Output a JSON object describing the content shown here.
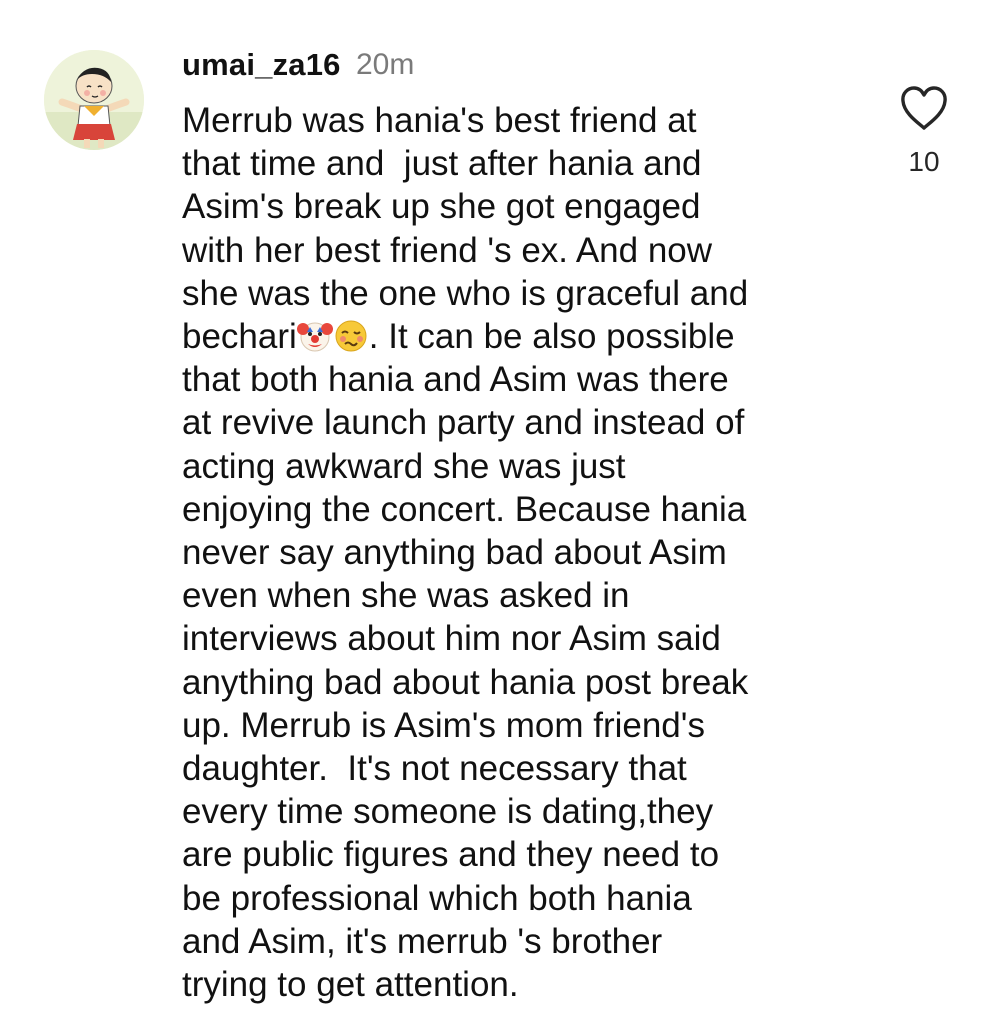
{
  "comment": {
    "username": "umai_za16",
    "timestamp": "20m",
    "like_count": "10",
    "avatar_icon": "cartoon-avatar-icon",
    "like_icon": "heart-outline-icon",
    "lines": [
      "Merrub was hania's best friend at",
      "that time and  just after hania and",
      "Asim's break up she got engaged",
      "with her best friend 's ex. And now",
      "she was the one who is graceful and",
      {
        "before": "bechari",
        "emojis": [
          "clown-face-emoji",
          "woozy-face-emoji"
        ],
        "after": ". It can be also possible"
      },
      "that both hania and Asim was there",
      "at revive launch party and instead of",
      "acting awkward she was just",
      "enjoying the concert. Because hania",
      "never say anything bad about Asim",
      "even when she was asked in",
      "interviews about him nor Asim said",
      "anything bad about hania post break",
      "up. Merrub is Asim's mom friend's",
      "daughter.  It's not necessary that",
      "every time someone is dating,they",
      "are public figures and they need to",
      "be professional which both hania",
      "and Asim, it's merrub 's brother",
      "trying to get attention."
    ]
  },
  "colors": {
    "background": "#ffffff",
    "text": "#111111",
    "timestamp": "#7a7a7a",
    "icon": "#262626"
  }
}
